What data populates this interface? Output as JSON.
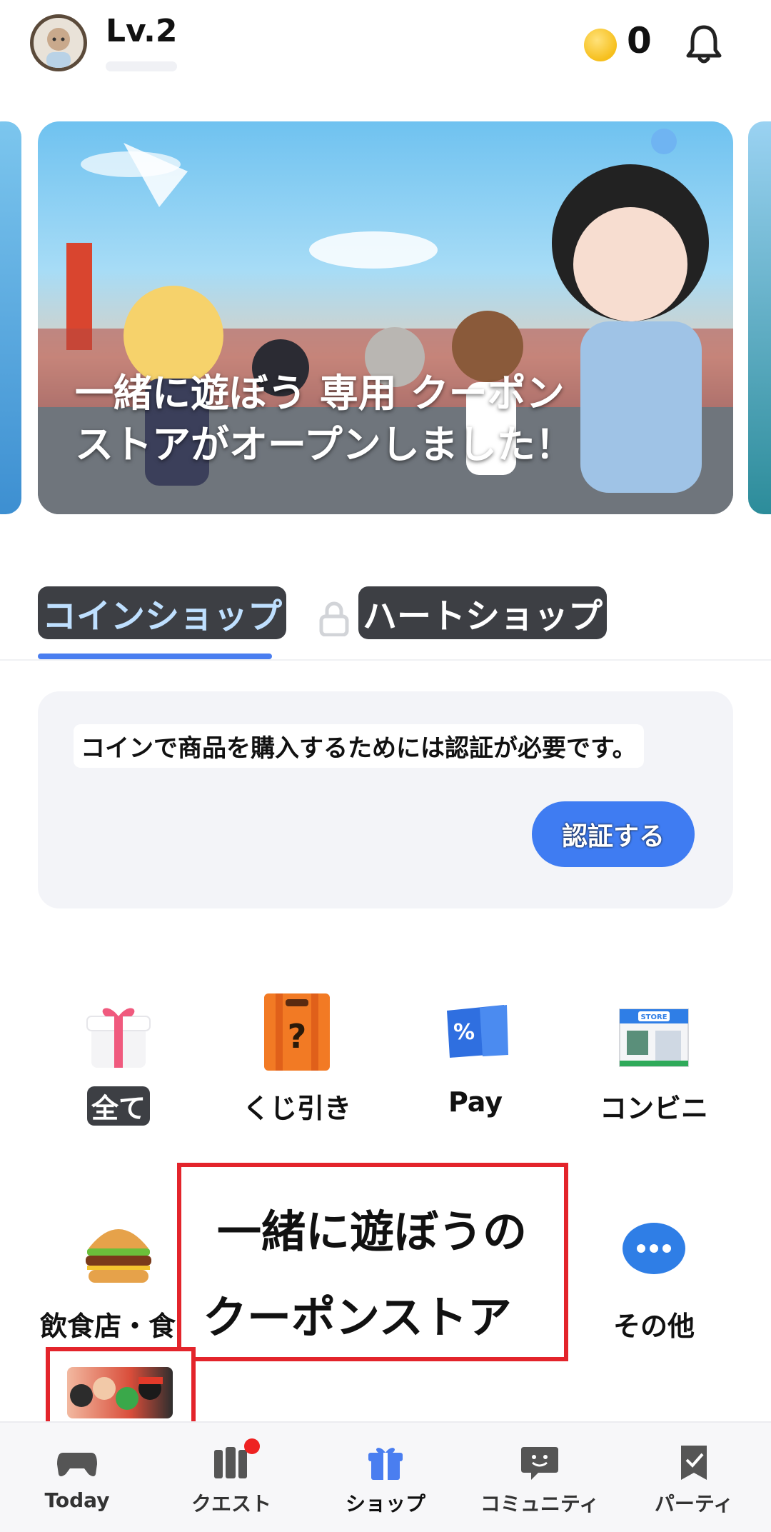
{
  "header": {
    "level": "Lv.2",
    "coin_count": "0"
  },
  "banner": {
    "line1": "一緒に遊ぼう 専用 クーポン",
    "line2": "ストアがオープンしました！"
  },
  "tabs": [
    {
      "label": "コインショップ",
      "active": true
    },
    {
      "label": "ハートショップ",
      "locked": true
    }
  ],
  "notice": {
    "text": "コインで商品を購入するためには認証が必要です。",
    "button": "認証する"
  },
  "categories": [
    {
      "label": "全て",
      "icon": "gift-icon"
    },
    {
      "label": "くじ引き",
      "icon": "lottery-box-icon"
    },
    {
      "label": "Pay",
      "icon": "pay-coupon-icon"
    },
    {
      "label": "コンビニ",
      "icon": "store-icon"
    },
    {
      "label": "飲食店・食品",
      "icon": "burger-icon"
    },
    {
      "label": "その他",
      "icon": "more-icon"
    }
  ],
  "overlay": {
    "line1": "一緒に遊ぼうの",
    "line2": "クーポンストア"
  },
  "nav": [
    {
      "label": "Today",
      "icon": "gamepad-icon"
    },
    {
      "label": "クエスト",
      "icon": "quest-icon",
      "badge": true
    },
    {
      "label": "ショップ",
      "icon": "shop-gift-icon",
      "active": true
    },
    {
      "label": "コミュニティ",
      "icon": "community-icon"
    },
    {
      "label": "パーティ",
      "icon": "party-icon"
    }
  ],
  "colors": {
    "accent": "#4a7ef0",
    "button": "#3f7cf2",
    "highlight_red": "#e3242b",
    "badge_red": "#ee2222"
  }
}
